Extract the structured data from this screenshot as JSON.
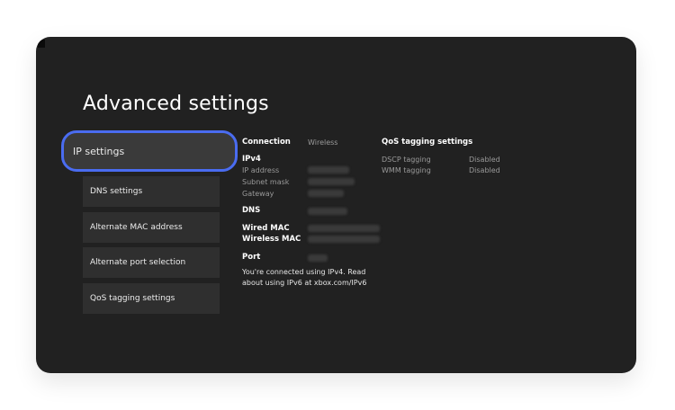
{
  "title": "Advanced settings",
  "menu": {
    "items": [
      {
        "label": "IP settings"
      },
      {
        "label": "DNS settings"
      },
      {
        "label": "Alternate MAC address"
      },
      {
        "label": "Alternate port selection"
      },
      {
        "label": "QoS tagging settings"
      }
    ],
    "selected": "IP settings"
  },
  "info": {
    "connection_label": "Connection",
    "connection_value": "Wireless",
    "ipv4_label": "IPv4",
    "ip_address_label": "IP address",
    "subnet_mask_label": "Subnet mask",
    "gateway_label": "Gateway",
    "dns_label": "DNS",
    "wired_mac_label": "Wired MAC",
    "wireless_mac_label": "Wireless MAC",
    "port_label": "Port",
    "note_line1": "You're connected using IPv4. Read",
    "note_line2": "about using IPv6 at xbox.com/IPv6"
  },
  "qos": {
    "heading": "QoS tagging settings",
    "dscp_label": "DSCP tagging",
    "dscp_value": "Disabled",
    "wmm_label": "WMM tagging",
    "wmm_value": "Disabled"
  },
  "colors": {
    "background": "#212121",
    "focus_ring": "#4a6cf0",
    "tile": "#2f2f2f",
    "selected_tile": "#3a3a3a"
  }
}
